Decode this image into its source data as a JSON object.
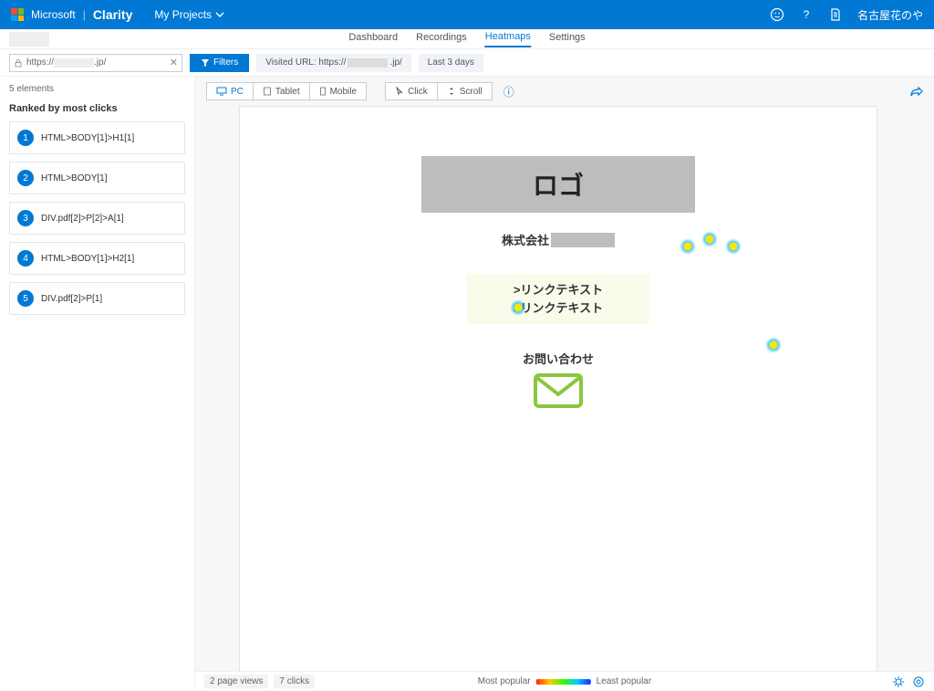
{
  "header": {
    "brand_ms": "Microsoft",
    "brand_product": "Clarity",
    "my_projects": "My Projects",
    "user_name": "名古屋花のや"
  },
  "project": {
    "name": ""
  },
  "tabs": {
    "dashboard": "Dashboard",
    "recordings": "Recordings",
    "heatmaps": "Heatmaps",
    "settings": "Settings"
  },
  "filters": {
    "url_prefix": "https://",
    "url_suffix": ".jp/",
    "filters_btn": "Filters",
    "visited_label": "Visited URL: https://",
    "visited_suffix": ".jp/",
    "date_range": "Last 3 days"
  },
  "sidebar": {
    "count_label": "5 elements",
    "rank_title": "Ranked by most clicks",
    "items": [
      {
        "n": "1",
        "label": "HTML>BODY[1]>H1[1]"
      },
      {
        "n": "2",
        "label": "HTML>BODY[1]"
      },
      {
        "n": "3",
        "label": "DIV.pdf[2]>P[2]>A[1]"
      },
      {
        "n": "4",
        "label": "HTML>BODY[1]>H2[1]"
      },
      {
        "n": "5",
        "label": "DIV.pdf[2]>P[1]"
      }
    ]
  },
  "toolbar": {
    "pc": "PC",
    "tablet": "Tablet",
    "mobile": "Mobile",
    "click": "Click",
    "scroll": "Scroll"
  },
  "canvas": {
    "logo_text": "ロゴ",
    "company_prefix": "株式会社",
    "link1": ">リンクテキスト",
    "link2": ">リンクテキスト",
    "contact_title": "お問い合わせ"
  },
  "footer": {
    "page_views": "2 page views",
    "clicks": "7 clicks",
    "most": "Most popular",
    "least": "Least popular"
  }
}
